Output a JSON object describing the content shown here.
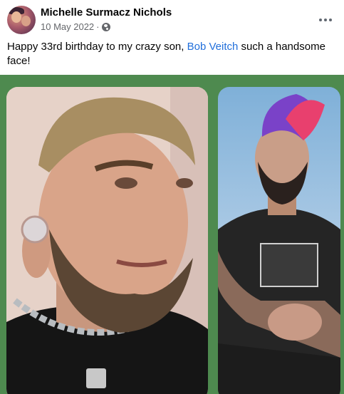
{
  "post": {
    "author": "Michelle Surmacz Nichols",
    "date": "10 May 2022",
    "separator": "·",
    "audience_icon": "globe-icon",
    "more_icon": "more-options-icon"
  },
  "caption": {
    "before_link": "Happy 33rd birthday to my crazy son, ",
    "link_text": "Bob Veitch",
    "after_link": " such a handsome face!"
  },
  "colors": {
    "link": "#216fdb",
    "photo_background": "#4e8a4f",
    "meta_text": "#65676b"
  }
}
